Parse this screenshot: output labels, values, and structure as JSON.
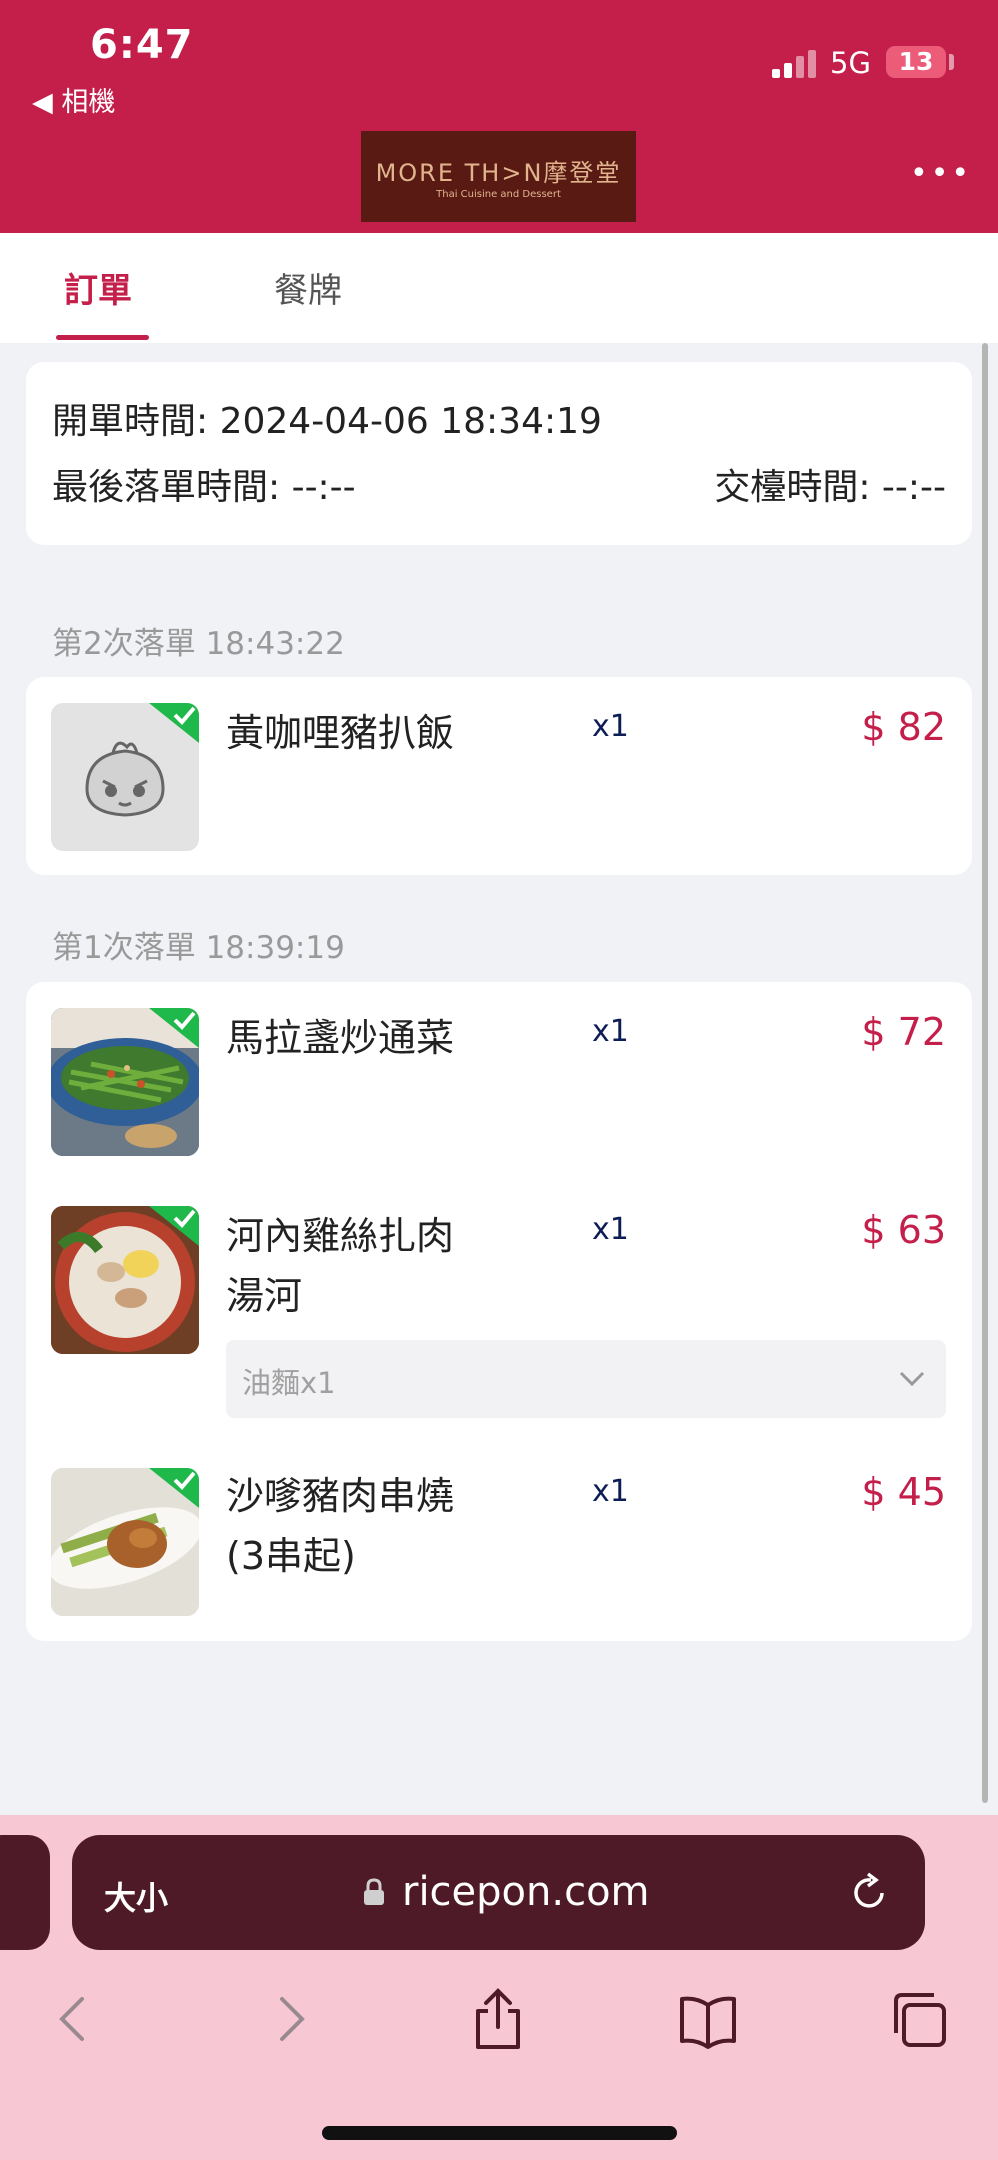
{
  "status_bar": {
    "time": "6:47",
    "back_label": "◀ 相機",
    "network": "5G",
    "battery": "13"
  },
  "header": {
    "logo_main": "MORE TH>N摩登堂",
    "logo_sub": "Thai Cuisine and Dessert",
    "more_icon": "more-dots-icon"
  },
  "tabs": [
    {
      "label": "訂單",
      "active": true
    },
    {
      "label": "餐牌",
      "active": false
    }
  ],
  "order_info": {
    "opened": "開單時間: 2024-04-06 18:34:19",
    "last_order": "最後落單時間: --:--",
    "checkout": "交檯時間: --:--"
  },
  "rounds": [
    {
      "label": "第2次落單 18:43:22",
      "items": [
        {
          "name": "黃咖哩豬扒飯",
          "qty": "x1",
          "price": "$ 82",
          "image": "placeholder-mascot-image"
        }
      ]
    },
    {
      "label": "第1次落單 18:39:19",
      "items": [
        {
          "name": "馬拉盞炒通菜",
          "qty": "x1",
          "price": "$ 72",
          "image": "stir-fried-greens-photo"
        },
        {
          "name": "河內雞絲扎肉湯河",
          "name_lines": [
            "河內雞絲扎肉",
            "湯河"
          ],
          "qty": "x1",
          "price": "$ 63",
          "image": "noodle-soup-photo",
          "option": "油麵x1"
        },
        {
          "name": "沙嗲豬肉串燒(3串起)",
          "name_lines": [
            "沙嗲豬肉串燒",
            "(3串起)"
          ],
          "qty": "x1",
          "price": "$ 45",
          "image": "satay-skewers-photo"
        }
      ]
    }
  ],
  "browser": {
    "text_size_label": "大小",
    "url": "ricepon.com"
  },
  "colors": {
    "brand": "#c41f4a",
    "price": "#c41f4a",
    "qty": "#0d1d55",
    "browser_pill": "#4f1a28",
    "browser_bar": "#f7c7d3",
    "check": "#1fb84a"
  }
}
